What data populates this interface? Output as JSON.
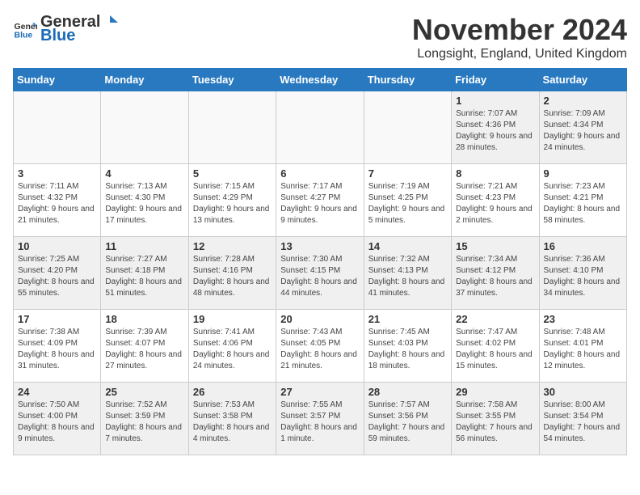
{
  "logo": {
    "general": "General",
    "blue": "Blue"
  },
  "header": {
    "month": "November 2024",
    "location": "Longsight, England, United Kingdom"
  },
  "days_of_week": [
    "Sunday",
    "Monday",
    "Tuesday",
    "Wednesday",
    "Thursday",
    "Friday",
    "Saturday"
  ],
  "weeks": [
    [
      {
        "day": "",
        "info": "",
        "empty": true
      },
      {
        "day": "",
        "info": "",
        "empty": true
      },
      {
        "day": "",
        "info": "",
        "empty": true
      },
      {
        "day": "",
        "info": "",
        "empty": true
      },
      {
        "day": "",
        "info": "",
        "empty": true
      },
      {
        "day": "1",
        "info": "Sunrise: 7:07 AM\nSunset: 4:36 PM\nDaylight: 9 hours and 28 minutes."
      },
      {
        "day": "2",
        "info": "Sunrise: 7:09 AM\nSunset: 4:34 PM\nDaylight: 9 hours and 24 minutes."
      }
    ],
    [
      {
        "day": "3",
        "info": "Sunrise: 7:11 AM\nSunset: 4:32 PM\nDaylight: 9 hours and 21 minutes."
      },
      {
        "day": "4",
        "info": "Sunrise: 7:13 AM\nSunset: 4:30 PM\nDaylight: 9 hours and 17 minutes."
      },
      {
        "day": "5",
        "info": "Sunrise: 7:15 AM\nSunset: 4:29 PM\nDaylight: 9 hours and 13 minutes."
      },
      {
        "day": "6",
        "info": "Sunrise: 7:17 AM\nSunset: 4:27 PM\nDaylight: 9 hours and 9 minutes."
      },
      {
        "day": "7",
        "info": "Sunrise: 7:19 AM\nSunset: 4:25 PM\nDaylight: 9 hours and 5 minutes."
      },
      {
        "day": "8",
        "info": "Sunrise: 7:21 AM\nSunset: 4:23 PM\nDaylight: 9 hours and 2 minutes."
      },
      {
        "day": "9",
        "info": "Sunrise: 7:23 AM\nSunset: 4:21 PM\nDaylight: 8 hours and 58 minutes."
      }
    ],
    [
      {
        "day": "10",
        "info": "Sunrise: 7:25 AM\nSunset: 4:20 PM\nDaylight: 8 hours and 55 minutes."
      },
      {
        "day": "11",
        "info": "Sunrise: 7:27 AM\nSunset: 4:18 PM\nDaylight: 8 hours and 51 minutes."
      },
      {
        "day": "12",
        "info": "Sunrise: 7:28 AM\nSunset: 4:16 PM\nDaylight: 8 hours and 48 minutes."
      },
      {
        "day": "13",
        "info": "Sunrise: 7:30 AM\nSunset: 4:15 PM\nDaylight: 8 hours and 44 minutes."
      },
      {
        "day": "14",
        "info": "Sunrise: 7:32 AM\nSunset: 4:13 PM\nDaylight: 8 hours and 41 minutes."
      },
      {
        "day": "15",
        "info": "Sunrise: 7:34 AM\nSunset: 4:12 PM\nDaylight: 8 hours and 37 minutes."
      },
      {
        "day": "16",
        "info": "Sunrise: 7:36 AM\nSunset: 4:10 PM\nDaylight: 8 hours and 34 minutes."
      }
    ],
    [
      {
        "day": "17",
        "info": "Sunrise: 7:38 AM\nSunset: 4:09 PM\nDaylight: 8 hours and 31 minutes."
      },
      {
        "day": "18",
        "info": "Sunrise: 7:39 AM\nSunset: 4:07 PM\nDaylight: 8 hours and 27 minutes."
      },
      {
        "day": "19",
        "info": "Sunrise: 7:41 AM\nSunset: 4:06 PM\nDaylight: 8 hours and 24 minutes."
      },
      {
        "day": "20",
        "info": "Sunrise: 7:43 AM\nSunset: 4:05 PM\nDaylight: 8 hours and 21 minutes."
      },
      {
        "day": "21",
        "info": "Sunrise: 7:45 AM\nSunset: 4:03 PM\nDaylight: 8 hours and 18 minutes."
      },
      {
        "day": "22",
        "info": "Sunrise: 7:47 AM\nSunset: 4:02 PM\nDaylight: 8 hours and 15 minutes."
      },
      {
        "day": "23",
        "info": "Sunrise: 7:48 AM\nSunset: 4:01 PM\nDaylight: 8 hours and 12 minutes."
      }
    ],
    [
      {
        "day": "24",
        "info": "Sunrise: 7:50 AM\nSunset: 4:00 PM\nDaylight: 8 hours and 9 minutes."
      },
      {
        "day": "25",
        "info": "Sunrise: 7:52 AM\nSunset: 3:59 PM\nDaylight: 8 hours and 7 minutes."
      },
      {
        "day": "26",
        "info": "Sunrise: 7:53 AM\nSunset: 3:58 PM\nDaylight: 8 hours and 4 minutes."
      },
      {
        "day": "27",
        "info": "Sunrise: 7:55 AM\nSunset: 3:57 PM\nDaylight: 8 hours and 1 minute."
      },
      {
        "day": "28",
        "info": "Sunrise: 7:57 AM\nSunset: 3:56 PM\nDaylight: 7 hours and 59 minutes."
      },
      {
        "day": "29",
        "info": "Sunrise: 7:58 AM\nSunset: 3:55 PM\nDaylight: 7 hours and 56 minutes."
      },
      {
        "day": "30",
        "info": "Sunrise: 8:00 AM\nSunset: 3:54 PM\nDaylight: 7 hours and 54 minutes."
      }
    ]
  ]
}
